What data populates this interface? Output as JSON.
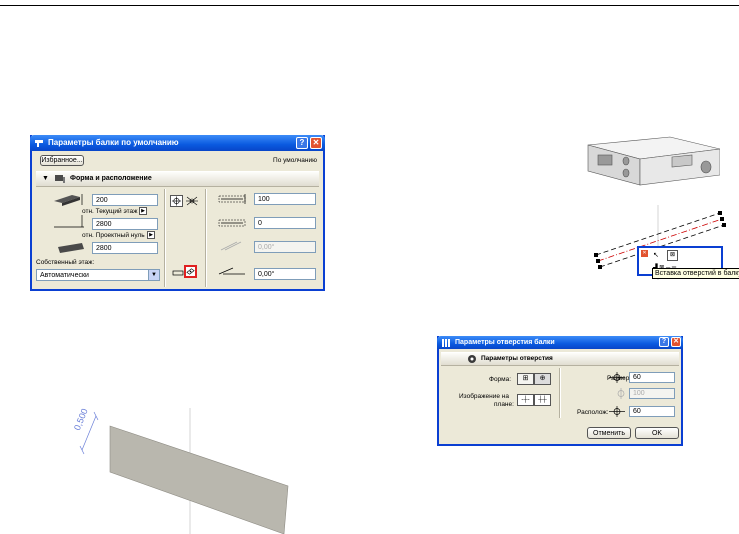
{
  "beam_dialog": {
    "title": "Параметры балки по умолчанию",
    "favorites_button": "Избранное...",
    "default_label": "По умолчанию",
    "section_title": "Форма и расположение",
    "height_value": "200",
    "top_offset_value": "2800",
    "top_ref_label": "отн. Текущий этаж",
    "bottom_value": "2800",
    "bottom_ref_label": "отн. Проектный нуль",
    "home_story_label": "Собственный этаж:",
    "home_story_value": "Автоматически",
    "width_value": "100",
    "offset_value": "0",
    "angle_value": "0,00°",
    "slant_value": "0,00°"
  },
  "tooltip": {
    "text": "Вставка отверстий в балку"
  },
  "hole_dialog": {
    "title": "Параметры отверстия балки",
    "section_title": "Параметры отверстия",
    "shape_label": "Форма:",
    "plan_label_1": "Изображение на",
    "plan_label_2": "плане:",
    "size_label": "Размер:",
    "size_value": "60",
    "second_size_value": "100",
    "position_label": "Располож:",
    "position_value": "60",
    "cancel_button": "Отменить",
    "ok_button": "OK"
  },
  "dimension": {
    "value": "0,500"
  },
  "colors": {
    "title_blue": "#0a5ae0",
    "dialog_bg": "#ece9d8",
    "highlight_red": "#e02020",
    "dimension_blue": "#6a7fd8",
    "beam_gray": "#b9b7ae"
  }
}
